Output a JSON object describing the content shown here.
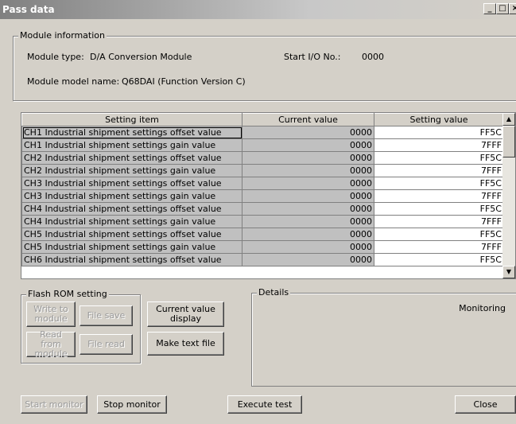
{
  "window": {
    "title": "Pass data",
    "min_icon": "minimize-icon",
    "max_icon": "maximize-icon",
    "close_icon": "close-icon"
  },
  "module_info": {
    "group_label": "Module information",
    "type_label": "Module type:",
    "type_value": "D/A Conversion Module",
    "start_io_label": "Start I/O No.:",
    "start_io_value": "0000",
    "model_label": "Module model name:",
    "model_value": "Q68DAI (Function Version C)"
  },
  "grid": {
    "headers": [
      "Setting item",
      "Current value",
      "Setting value"
    ],
    "rows": [
      [
        "CH1 Industrial shipment settings offset value",
        "0000",
        "FF5C"
      ],
      [
        "CH1 Industrial shipment settings gain value",
        "0000",
        "7FFF"
      ],
      [
        "CH2 Industrial shipment settings offset value",
        "0000",
        "FF5C"
      ],
      [
        "CH2 Industrial shipment settings gain value",
        "0000",
        "7FFF"
      ],
      [
        "CH3 Industrial shipment settings offset value",
        "0000",
        "FF5C"
      ],
      [
        "CH3 Industrial shipment settings gain value",
        "0000",
        "7FFF"
      ],
      [
        "CH4 Industrial shipment settings offset value",
        "0000",
        "FF5C"
      ],
      [
        "CH4 Industrial shipment settings gain value",
        "0000",
        "7FFF"
      ],
      [
        "CH5 Industrial shipment settings offset value",
        "0000",
        "FF5C"
      ],
      [
        "CH5 Industrial shipment settings gain value",
        "0000",
        "7FFF"
      ],
      [
        "CH6 Industrial shipment settings offset value",
        "0000",
        "FF5C"
      ]
    ]
  },
  "flash_rom": {
    "group_label": "Flash ROM setting",
    "write_to_module": "Write to module",
    "file_save": "File save",
    "read_from_module": "Read from module",
    "file_read": "File read",
    "current_value_display": "Current value display",
    "make_text_file": "Make text file"
  },
  "details": {
    "group_label": "Details",
    "status": "Monitoring"
  },
  "buttons": {
    "start_monitor": "Start monitor",
    "stop_monitor": "Stop monitor",
    "execute_test": "Execute test",
    "close": "Close"
  }
}
